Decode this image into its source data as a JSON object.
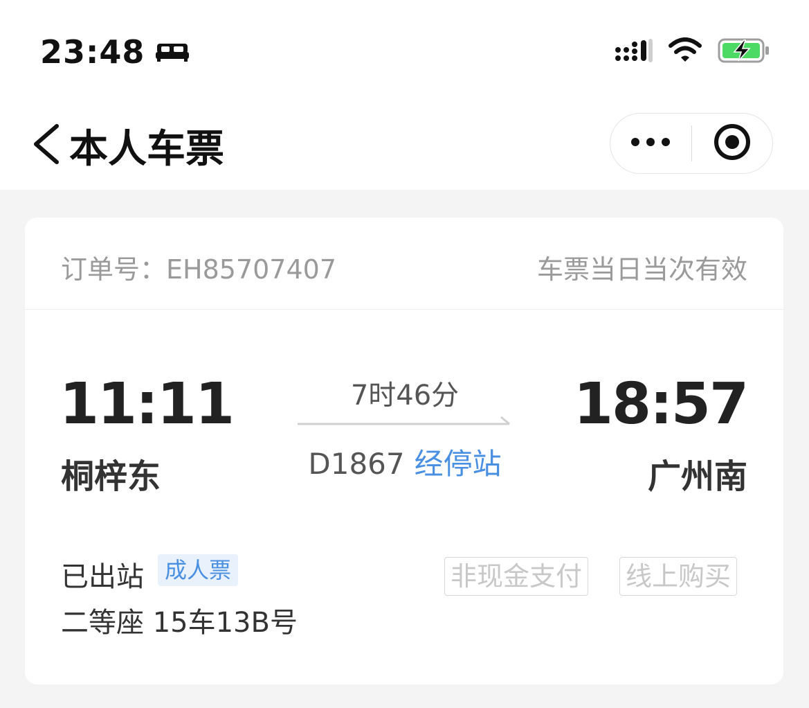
{
  "status_bar": {
    "time": "23:48",
    "icons": [
      "bed-icon",
      "signal-icon",
      "wifi-icon",
      "battery-charging-icon"
    ]
  },
  "nav": {
    "title": "本人车票",
    "icons": [
      "chevron-left-icon",
      "more-dots-icon",
      "target-close-icon"
    ]
  },
  "ticket": {
    "order_label": "订单号：EH85707407",
    "valid_note": "车票当日当次有效",
    "departure": {
      "time": "11:11",
      "station": "桐梓东"
    },
    "arrival": {
      "time": "18:57",
      "station": "广州南"
    },
    "duration": "7时46分",
    "train_no": "D1867",
    "stops_link": "经停站",
    "exit_status": "已出站",
    "ticket_type": "成人票",
    "seat": "二等座  15车13B号",
    "tags": [
      "非现金支付",
      "线上购买"
    ]
  },
  "colors": {
    "link": "#4a90e2",
    "badge_bg": "#e9f1fc",
    "battery_fill": "#4cd964",
    "page_bg": "#f4f4f4"
  }
}
